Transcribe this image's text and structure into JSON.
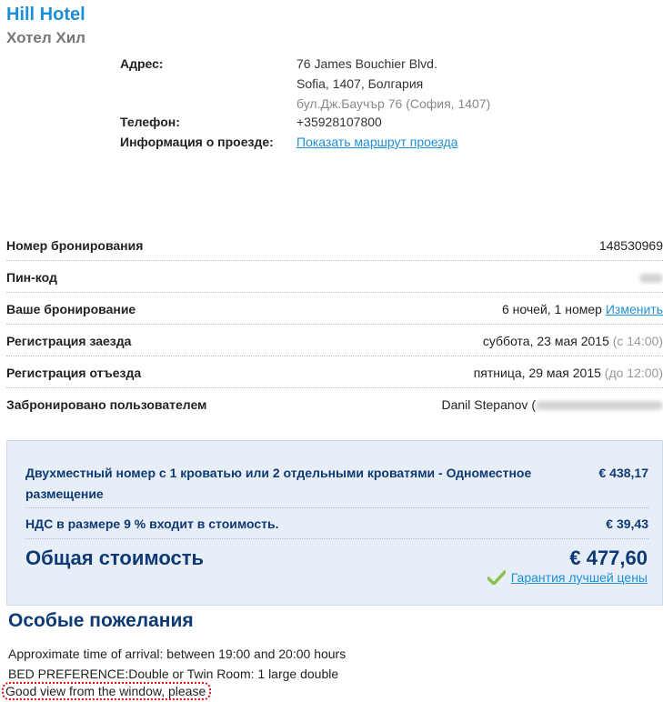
{
  "hotel": {
    "name": "Hill Hotel",
    "local_name": "Хотел Хил"
  },
  "info": {
    "address_label": "Адрес:",
    "address_line1": "76 James Bouchier Blvd.",
    "address_line2": "Sofia, 1407, Болгария",
    "address_line3": "бул.Дж.Баучър 76 (София, 1407)",
    "phone_label": "Телефон:",
    "phone_value": "+35928107800",
    "directions_label": "Информация о проезде:",
    "directions_link": "Показать маршрут проезда"
  },
  "booking": {
    "rows": [
      {
        "label": "Номер бронирования",
        "value": "148530969"
      },
      {
        "label": "Пин-код",
        "value": ""
      },
      {
        "label": "Ваше бронирование",
        "value": "6 ночей, 1 номер",
        "link": "Изменить"
      },
      {
        "label": "Регистрация заезда",
        "value": "суббота, 23 мая 2015",
        "extra": "(с 14:00)"
      },
      {
        "label": "Регистрация отъезда",
        "value": "пятница, 29 мая 2015",
        "extra": "(до 12:00)"
      },
      {
        "label": "Забронировано пользователем",
        "value": "Danil Stepanov ("
      }
    ]
  },
  "price": {
    "room_desc": "Двухместный номер с 1 кроватью или 2 отдельными кроватями - Одноместное размещение",
    "room_amount": "€ 438,17",
    "vat_desc": "НДС в размере 9 % входит в стоимость.",
    "vat_amount": "€ 39,43",
    "total_label": "Общая стоимость",
    "total_amount": "€ 477,60",
    "guarantee_link": "Гарантия лучшей цены"
  },
  "special": {
    "title": "Особые пожелания",
    "requests": [
      "Approximate time of arrival: between 19:00 and 20:00 hours",
      "BED PREFERENCE:Double or Twin Room: 1 large double",
      "Good view from the window, please"
    ]
  },
  "colors": {
    "accent": "#1d8fd8",
    "navy": "#0d3a75",
    "price_bg": "#e8eef7",
    "highlight": "#e01010"
  }
}
